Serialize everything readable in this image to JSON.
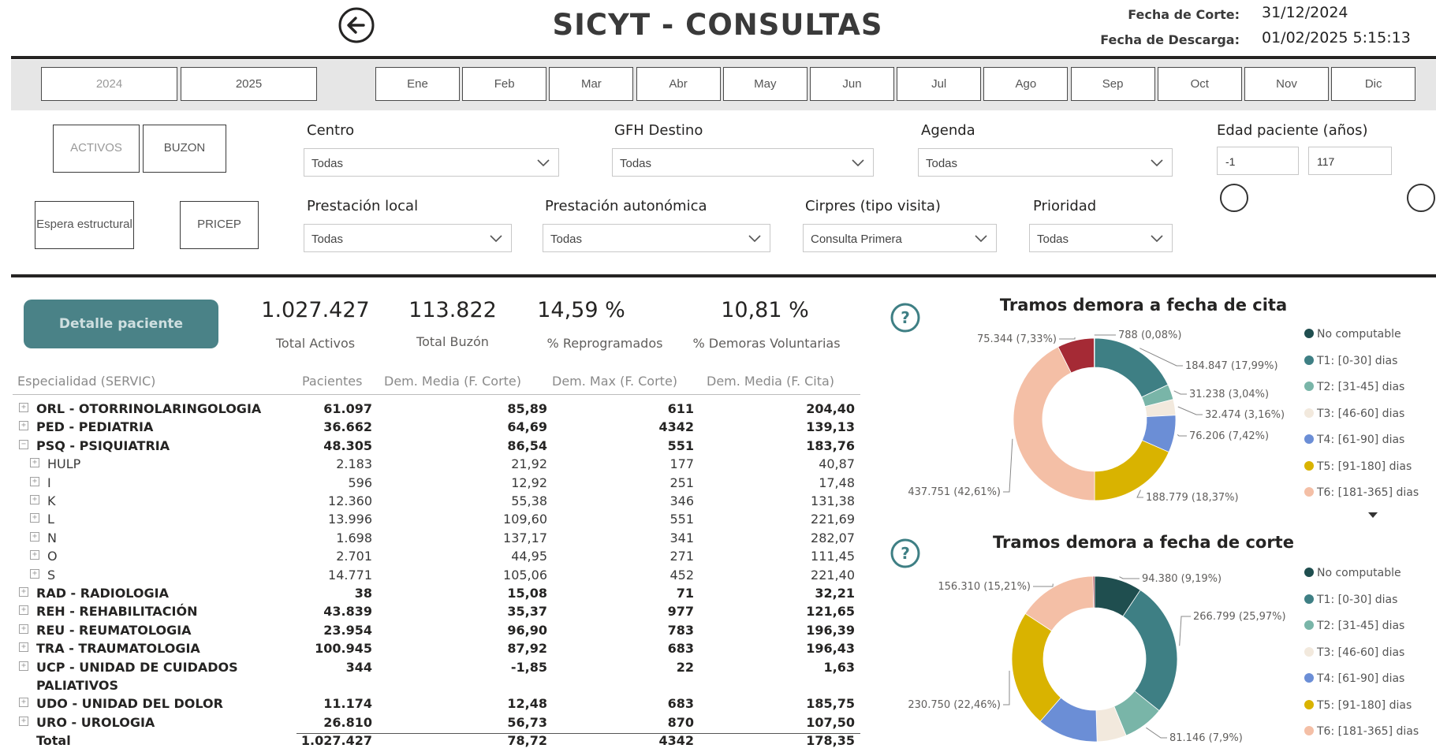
{
  "header": {
    "title": "SICYT - CONSULTAS",
    "fecha_corte_label": "Fecha de Corte:",
    "fecha_corte": "31/12/2024",
    "fecha_descarga_label": "Fecha de Descarga:",
    "fecha_descarga": "01/02/2025 5:15:13"
  },
  "years": [
    "2024",
    "2025"
  ],
  "months": [
    "Ene",
    "Feb",
    "Mar",
    "Abr",
    "May",
    "Jun",
    "Jul",
    "Ago",
    "Sep",
    "Oct",
    "Nov",
    "Dic"
  ],
  "buttons": {
    "activos": "ACTIVOS",
    "buzon": "BUZON",
    "espera": "Espera estructural",
    "pricep": "PRICEP",
    "detalle": "Detalle paciente"
  },
  "filters": {
    "centro": {
      "label": "Centro",
      "value": "Todas"
    },
    "gfh": {
      "label": "GFH Destino",
      "value": "Todas"
    },
    "agenda": {
      "label": "Agenda",
      "value": "Todas"
    },
    "edad": {
      "label": "Edad paciente (años)",
      "min": "-1",
      "max": "117"
    },
    "prest_local": {
      "label": "Prestación local",
      "value": "Todas"
    },
    "prest_auto": {
      "label": "Prestación autonómica",
      "value": "Todas"
    },
    "cirpres": {
      "label": "Cirpres (tipo visita)",
      "value": "Consulta Primera"
    },
    "prioridad": {
      "label": "Prioridad",
      "value": "Todas"
    }
  },
  "kpis": [
    {
      "value": "1.027.427",
      "label": "Total Activos"
    },
    {
      "value": "113.822",
      "label": "Total Buzón"
    },
    {
      "value": "14,59 %",
      "label": "% Reprogramados"
    },
    {
      "value": "10,81 %",
      "label": "% Demoras Voluntarias"
    }
  ],
  "table": {
    "headers": [
      "Especialidad (SERVIC)",
      "Pacientes",
      "Dem. Media (F. Corte)",
      "Dem. Max (F. Corte)",
      "Dem. Media  (F. Cita)"
    ],
    "rows": [
      {
        "name": "ORL - OTORRINOLARINGOLOGIA",
        "level": 0,
        "exp": "+",
        "c": [
          "61.097",
          "85,89",
          "611",
          "204,40"
        ]
      },
      {
        "name": "PED - PEDIATRIA",
        "level": 0,
        "exp": "+",
        "c": [
          "36.662",
          "64,69",
          "4342",
          "139,13"
        ]
      },
      {
        "name": "PSQ - PSIQUIATRIA",
        "level": 0,
        "exp": "−",
        "c": [
          "48.305",
          "86,54",
          "551",
          "183,76"
        ]
      },
      {
        "name": "HULP",
        "level": 1,
        "exp": "+",
        "c": [
          "2.183",
          "21,92",
          "177",
          "40,87"
        ]
      },
      {
        "name": "I",
        "level": 1,
        "exp": "+",
        "c": [
          "596",
          "12,92",
          "251",
          "17,48"
        ]
      },
      {
        "name": "K",
        "level": 1,
        "exp": "+",
        "c": [
          "12.360",
          "55,38",
          "346",
          "131,38"
        ]
      },
      {
        "name": "L",
        "level": 1,
        "exp": "+",
        "c": [
          "13.996",
          "109,60",
          "551",
          "221,69"
        ]
      },
      {
        "name": "N",
        "level": 1,
        "exp": "+",
        "c": [
          "1.698",
          "137,17",
          "341",
          "282,07"
        ]
      },
      {
        "name": "O",
        "level": 1,
        "exp": "+",
        "c": [
          "2.701",
          "44,95",
          "271",
          "111,45"
        ]
      },
      {
        "name": "S",
        "level": 1,
        "exp": "+",
        "c": [
          "14.771",
          "105,06",
          "452",
          "221,40"
        ]
      },
      {
        "name": "RAD - RADIOLOGIA",
        "level": 0,
        "exp": "+",
        "c": [
          "38",
          "15,08",
          "71",
          "32,21"
        ]
      },
      {
        "name": "REH - REHABILITACIÓN",
        "level": 0,
        "exp": "+",
        "c": [
          "43.839",
          "35,37",
          "977",
          "121,65"
        ]
      },
      {
        "name": "REU - REUMATOLOGIA",
        "level": 0,
        "exp": "+",
        "c": [
          "23.954",
          "96,90",
          "783",
          "196,39"
        ]
      },
      {
        "name": "TRA - TRAUMATOLOGIA",
        "level": 0,
        "exp": "+",
        "c": [
          "100.945",
          "87,92",
          "683",
          "196,43"
        ]
      },
      {
        "name": "UCP - UNIDAD DE CUIDADOS",
        "name2": "PALIATIVOS",
        "level": 0,
        "exp": "+",
        "c": [
          "344",
          "-1,85",
          "22",
          "1,63"
        ]
      },
      {
        "name": "UDO - UNIDAD DEL DOLOR",
        "level": 0,
        "exp": "+",
        "c": [
          "11.174",
          "12,48",
          "683",
          "185,75"
        ]
      },
      {
        "name": "URO - UROLOGIA",
        "level": 0,
        "exp": "+",
        "c": [
          "26.810",
          "56,73",
          "870",
          "107,50"
        ]
      }
    ],
    "total": {
      "name": "Total",
      "c": [
        "1.027.427",
        "78,72",
        "4342",
        "178,35"
      ]
    }
  },
  "legend": [
    {
      "label": "No computable",
      "color": "#1f4e4f"
    },
    {
      "label": "T1: [0-30] dias",
      "color": "#3e7f84"
    },
    {
      "label": "T2: [31-45] dias",
      "color": "#79b5a8"
    },
    {
      "label": "T3: [46-60] dias",
      "color": "#f2e9dd"
    },
    {
      "label": "T4: [61-90] dias",
      "color": "#6b8ed6"
    },
    {
      "label": "T5: [91-180] dias",
      "color": "#d9b300"
    },
    {
      "label": "T6: [181-365] dias",
      "color": "#f4bfa6"
    }
  ],
  "chart_data": [
    {
      "type": "pie",
      "title": "Tramos demora a fecha de cita",
      "slices": [
        {
          "label": "T1: [0-30] dias",
          "value": 184847,
          "text": "184.847 (17,99%)",
          "color": "#3e7f84"
        },
        {
          "label": "T2: [31-45] dias",
          "value": 31238,
          "text": "31.238 (3,04%)",
          "color": "#79b5a8"
        },
        {
          "label": "T3: [46-60] dias",
          "value": 32474,
          "text": "32.474 (3,16%)",
          "color": "#f2e9dd"
        },
        {
          "label": "T4: [61-90] dias",
          "value": 76206,
          "text": "76.206 (7,42%)",
          "color": "#6b8ed6"
        },
        {
          "label": "T5: [91-180] dias",
          "value": 188779,
          "text": "188.779 (18,37%)",
          "color": "#d9b300"
        },
        {
          "label": "T6: [181-365] dias",
          "value": 437751,
          "text": "437.751 (42,61%)",
          "color": "#f4bfa6"
        },
        {
          "label": "",
          "value": 75344,
          "text": "75.344 (7,33%)",
          "color": "#a52a35"
        },
        {
          "label": "",
          "value": 788,
          "text": "788 (0,08%)",
          "color": "#e07a5a"
        }
      ]
    },
    {
      "type": "pie",
      "title": "Tramos demora a fecha de corte",
      "slices": [
        {
          "label": "No computable",
          "value": 94380,
          "text": "94.380 (9,19%)",
          "color": "#1f4e4f"
        },
        {
          "label": "T1: [0-30] dias",
          "value": 266799,
          "text": "266.799 (25,97%)",
          "color": "#3e7f84"
        },
        {
          "label": "T2: [31-45] dias",
          "value": 81146,
          "text": "81.146 (7,9%)",
          "color": "#79b5a8"
        },
        {
          "label": "T3: [46-60] dias",
          "value": 58000,
          "text": "",
          "color": "#f2e9dd"
        },
        {
          "label": "T4: [61-90] dias",
          "value": 120108,
          "text": "120.108 (11,69%)",
          "color": "#6b8ed6"
        },
        {
          "label": "T5: [91-180] dias",
          "value": 230750,
          "text": "230.750 (22,46%)",
          "color": "#d9b300"
        },
        {
          "label": "T6: [181-365] dias",
          "value": 156310,
          "text": "156.310 (15,21%)",
          "color": "#f4bfa6"
        },
        {
          "label": "",
          "value": 3000,
          "text": "",
          "color": "#a52a35"
        }
      ]
    }
  ]
}
